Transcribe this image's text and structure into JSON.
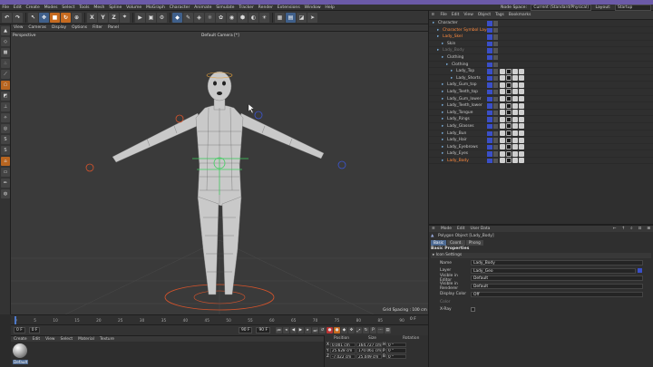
{
  "menubar": {
    "items": [
      "File",
      "Edit",
      "Create",
      "Modes",
      "Select",
      "Tools",
      "Mesh",
      "Spline",
      "Volume",
      "MoGraph",
      "Character",
      "Animate",
      "Simulate",
      "Tracker",
      "Render",
      "Extensions",
      "Window",
      "Help"
    ],
    "node_space_label": "Node Space:",
    "node_space_value": "Current (Standard/Physical)",
    "layout_label": "Layout:",
    "layout_value": "Startup"
  },
  "toolbar": {
    "axis_buttons": [
      "X",
      "Y",
      "Z"
    ]
  },
  "viewport": {
    "menu": [
      "View",
      "Cameras",
      "Display",
      "Options",
      "Filter",
      "Panel"
    ],
    "view_name": "Perspective",
    "camera_name": "Default Camera [*]",
    "grid_spacing": "Grid Spacing : 100 cm"
  },
  "timeline": {
    "ticks": [
      "0",
      "5",
      "10",
      "15",
      "20",
      "25",
      "30",
      "35",
      "40",
      "45",
      "50",
      "55",
      "60",
      "65",
      "70",
      "75",
      "80",
      "85",
      "90"
    ],
    "end_label": "0 F"
  },
  "transport": {
    "start": "0 F",
    "current": "0 F",
    "end1": "90 F",
    "end2": "90 F"
  },
  "material": {
    "menu": [
      "Create",
      "Edit",
      "View",
      "Select",
      "Material",
      "Texture"
    ],
    "swatch_label": "Default"
  },
  "coords": {
    "headers": [
      "Position",
      "Size",
      "Rotation"
    ],
    "rows": [
      {
        "axis": "X",
        "pos": "0.001 cm",
        "size": "164.727 cm",
        "rot_axis": "H",
        "rot": "0 °"
      },
      {
        "axis": "Y",
        "pos": "25.628 cm",
        "size": "170.061 cm",
        "rot_axis": "P",
        "rot": "0 °"
      },
      {
        "axis": "Z",
        "pos": "-7.022 cm",
        "size": "25.049 cm",
        "rot_axis": "B",
        "rot": "0 °"
      }
    ]
  },
  "objects": {
    "menu": [
      "File",
      "Edit",
      "View",
      "Object",
      "Tags",
      "Bookmarks"
    ],
    "rows": [
      {
        "name": "Character",
        "indent": 0,
        "style": "",
        "tags": false
      },
      {
        "name": "Character Symbol Layer",
        "indent": 1,
        "style": "sel",
        "tags": false
      },
      {
        "name": "Lady_Skel",
        "indent": 1,
        "style": "sel",
        "tags": false
      },
      {
        "name": "Skin",
        "indent": 2,
        "style": "",
        "tags": false
      },
      {
        "name": "Lady_Body",
        "indent": 1,
        "style": "dim",
        "tags": false
      },
      {
        "name": "Clothing",
        "indent": 2,
        "style": "",
        "tags": false
      },
      {
        "name": "Clothing",
        "indent": 3,
        "style": "",
        "tags": false
      },
      {
        "name": "Lady_Top",
        "indent": 4,
        "style": "",
        "tags": true
      },
      {
        "name": "Lady_Shorts",
        "indent": 4,
        "style": "",
        "tags": true
      },
      {
        "name": "Lady_Gum_top",
        "indent": 2,
        "style": "",
        "tags": true
      },
      {
        "name": "Lady_Teeth_top",
        "indent": 2,
        "style": "",
        "tags": true
      },
      {
        "name": "Lady_Gum_lower",
        "indent": 2,
        "style": "",
        "tags": true
      },
      {
        "name": "Lady_Teeth_lower",
        "indent": 2,
        "style": "",
        "tags": true
      },
      {
        "name": "Lady_Tongue",
        "indent": 2,
        "style": "",
        "tags": true
      },
      {
        "name": "Lady_Rings",
        "indent": 2,
        "style": "",
        "tags": true
      },
      {
        "name": "Lady_Glasses",
        "indent": 2,
        "style": "",
        "tags": true
      },
      {
        "name": "Lady_Bun",
        "indent": 2,
        "style": "",
        "tags": true
      },
      {
        "name": "Lady_Hair",
        "indent": 2,
        "style": "",
        "tags": true
      },
      {
        "name": "Lady_Eyebrows",
        "indent": 2,
        "style": "",
        "tags": true
      },
      {
        "name": "Lady_Eyes",
        "indent": 2,
        "style": "",
        "tags": true
      },
      {
        "name": "Lady_Body",
        "indent": 2,
        "style": "sel",
        "tags": true
      }
    ]
  },
  "attributes": {
    "menu": [
      "Mode",
      "Edit",
      "User Data"
    ],
    "object_title": "Polygon Object [Lady_Body]",
    "tabs": [
      "Basic",
      "Coord.",
      "Phong"
    ],
    "header": "Basic Properties",
    "section": "Icon Settings",
    "fields": [
      {
        "label": "Name",
        "value": "Lady_Body"
      },
      {
        "label": "Layer",
        "value": "Lady_Geo"
      },
      {
        "label": "Visible in Editor",
        "value": "Default"
      },
      {
        "label": "Visible in Renderer",
        "value": "Default"
      },
      {
        "label": "Display Color",
        "value": "Off"
      },
      {
        "label": "Color",
        "value": ""
      },
      {
        "label": "X-Ray",
        "value": ""
      }
    ]
  }
}
